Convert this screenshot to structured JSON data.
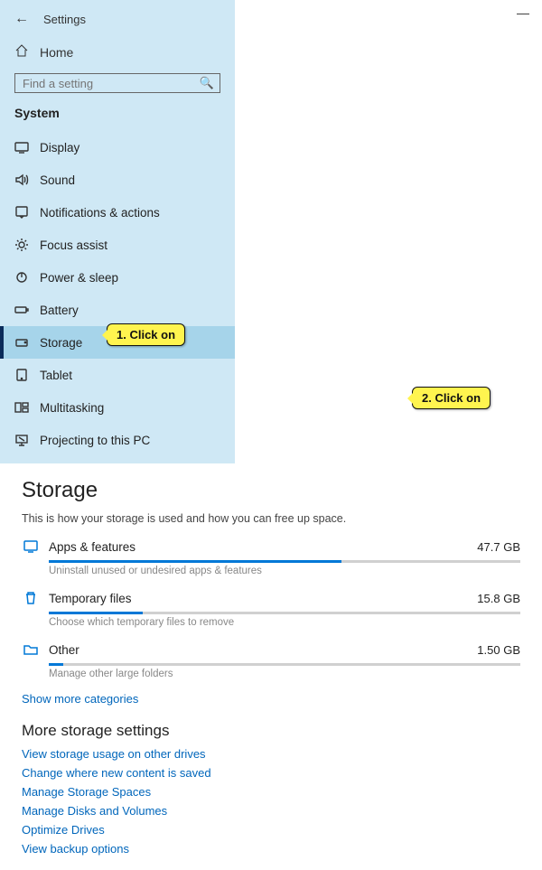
{
  "header": {
    "settings_label": "Settings",
    "minimize": "—"
  },
  "sidebar": {
    "home_label": "Home",
    "search_placeholder": "Find a setting",
    "section": "System",
    "items": [
      {
        "label": "Display"
      },
      {
        "label": "Sound"
      },
      {
        "label": "Notifications & actions"
      },
      {
        "label": "Focus assist"
      },
      {
        "label": "Power & sleep"
      },
      {
        "label": "Battery"
      },
      {
        "label": "Storage"
      },
      {
        "label": "Tablet"
      },
      {
        "label": "Multitasking"
      },
      {
        "label": "Projecting to this PC"
      }
    ]
  },
  "main": {
    "title": "Storage",
    "desc": "This is how your storage is used and how you can free up space.",
    "cats": [
      {
        "name": "Apps & features",
        "size": "47.7 GB",
        "hint": "Uninstall unused or undesired apps & features",
        "pct": 62
      },
      {
        "name": "Temporary files",
        "size": "15.8 GB",
        "hint": "Choose which temporary files to remove",
        "pct": 20
      },
      {
        "name": "Other",
        "size": "1.50 GB",
        "hint": "Manage other large folders",
        "pct": 3
      }
    ],
    "show_more": "Show more categories",
    "section2": "More storage settings",
    "links": [
      "View storage usage on other drives",
      "Change where new content is saved",
      "Manage Storage Spaces",
      "Manage Disks and Volumes",
      "Optimize Drives",
      "View backup options"
    ]
  },
  "callouts": {
    "c1": "1. Click on",
    "c2": "2. Click on"
  }
}
